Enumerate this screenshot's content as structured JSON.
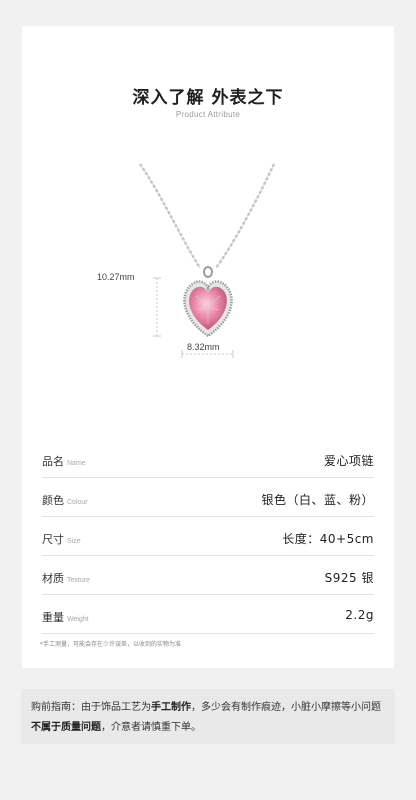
{
  "header": {
    "title": "深入了解 外表之下",
    "subtitle": "Product Attribute"
  },
  "dimensions": {
    "height": "10.27mm",
    "width": "8.32mm"
  },
  "specs": [
    {
      "label": "品名",
      "label_en": "Name",
      "value": "爱心项链"
    },
    {
      "label": "颜色",
      "label_en": "Colour",
      "value": "银色（白、蓝、粉）"
    },
    {
      "label": "尺寸",
      "label_en": "Size",
      "value": "长度：40+5cm"
    },
    {
      "label": "材质",
      "label_en": "Texture",
      "value": "S925 银"
    },
    {
      "label": "重量",
      "label_en": "Weight",
      "value": "2.2g"
    }
  ],
  "footnote": "*手工测量，可能会存在少许误差，以收到的实物为准",
  "notice": {
    "lead": "购前指南：由于饰品工艺为",
    "bold1": "手工制作",
    "mid": "，多少会有制作痕迹，小脏小摩擦等小问题",
    "bold2": "不属于质量问题",
    "tail": "，介意者请慎重下单。"
  },
  "colors": {
    "gem": "#e98aa6",
    "gem_dark": "#c9567a",
    "silver": "#b8b8b8",
    "background": "#f1f1f1",
    "notice_bg": "#e9e9e9"
  },
  "icons": [
    "heart-pendant-necklace"
  ]
}
